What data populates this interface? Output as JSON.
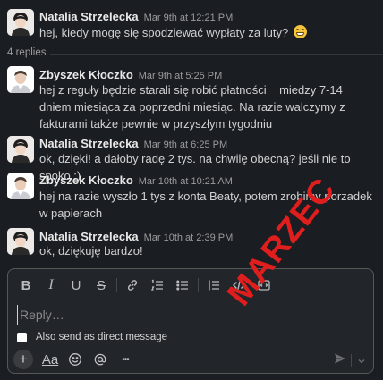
{
  "messages": [
    {
      "author": "Natalia Strzelecka",
      "time": "Mar 9th at 12:21 PM",
      "text": "hej, kiedy mogę się spodziewać wypłaty za luty?",
      "emoji": "grimacing-emoji"
    },
    {
      "author": "Zbyszek Kłoczko",
      "time": "Mar 9th at 5:25 PM",
      "text": "hej z reguły będzie starali się robić płatności    miedzy 7-14 dniem miesiąca za poprzedni miesiąc. Na razie walczymy z fakturami także pewnie w przyszłym tygodniu"
    },
    {
      "author": "Natalia Strzelecka",
      "time": "Mar 9th at 6:25 PM",
      "text": "ok, dzięki! a dałoby radę 2 tys. na chwilę obecną? jeśli nie to spoko :)"
    },
    {
      "author": "Zbyszek Kłoczko",
      "time": "Mar 10th at 10:21 AM",
      "text": "hej na razie wyszło 1 tys z konta Beaty, potem zrobimy porzadek w papierach"
    },
    {
      "author": "Natalia Strzelecka",
      "time": "Mar 10th at 2:39 PM",
      "text": "ok, dziękuję bardzo!"
    }
  ],
  "thread": {
    "replies_label": "4 replies"
  },
  "composer": {
    "placeholder": "Reply…",
    "also_send_label": "Also send as direct message",
    "toolbar": {
      "bold": "B",
      "italic": "I",
      "underline": "U",
      "strike": "S"
    },
    "bottom": {
      "plus": "+",
      "format": "Aa",
      "more": "•••"
    }
  },
  "stamp": {
    "text": "MARZEC",
    "color": "#e01e1e"
  },
  "colors": {
    "background": "#1a1d21",
    "composer_bg": "#222529",
    "text": "#d1d2d3"
  }
}
